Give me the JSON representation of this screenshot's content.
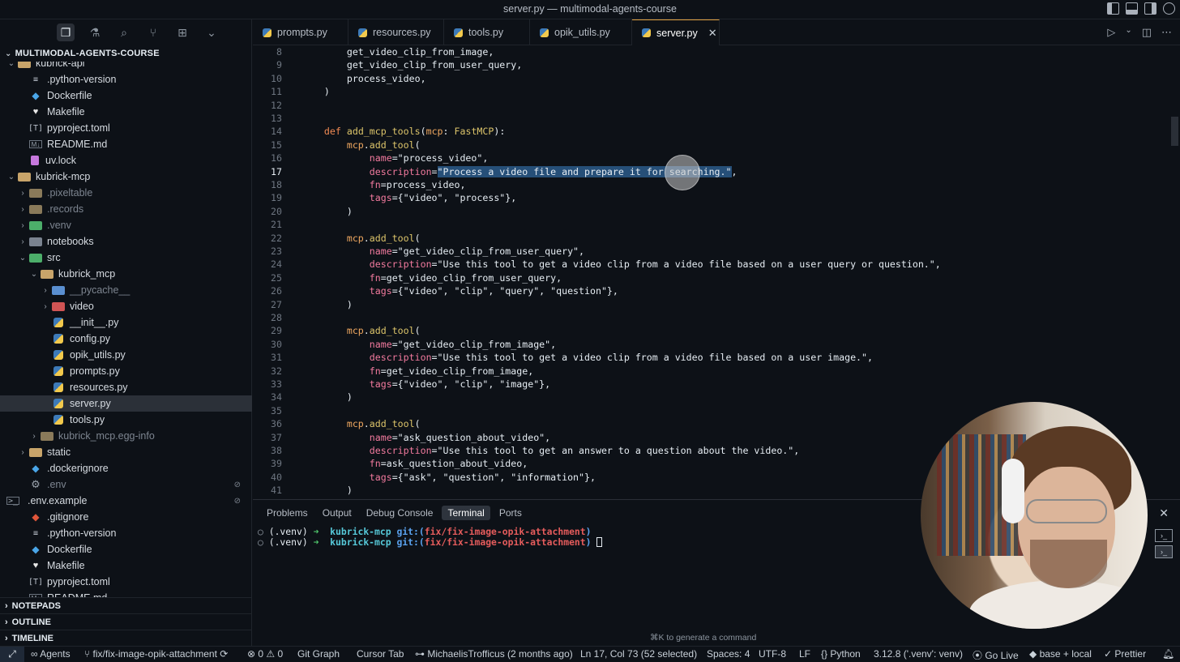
{
  "window": {
    "title": "server.py — multimodal-agents-course"
  },
  "sidebar": {
    "root": "MULTIMODAL-AGENTS-COURSE",
    "items": [
      {
        "label": "kubrick-api",
        "type": "folder",
        "depth": 1,
        "open": true
      },
      {
        "label": ".python-version",
        "type": "file",
        "depth": 2
      },
      {
        "label": "Dockerfile",
        "type": "docker",
        "depth": 2
      },
      {
        "label": "Makefile",
        "type": "make",
        "depth": 2
      },
      {
        "label": "pyproject.toml",
        "type": "toml",
        "depth": 2
      },
      {
        "label": "README.md",
        "type": "md",
        "depth": 2
      },
      {
        "label": "uv.lock",
        "type": "lock",
        "depth": 2
      },
      {
        "label": "kubrick-mcp",
        "type": "folder",
        "depth": 1,
        "open": true
      },
      {
        "label": ".pixeltable",
        "type": "folder-dim",
        "depth": 2,
        "open": false,
        "dim": true
      },
      {
        "label": ".records",
        "type": "folder-dim",
        "depth": 2,
        "open": false,
        "dim": true
      },
      {
        "label": ".venv",
        "type": "folder-green",
        "depth": 2,
        "open": false,
        "dim": true
      },
      {
        "label": "notebooks",
        "type": "folder-gray",
        "depth": 2,
        "open": false
      },
      {
        "label": "src",
        "type": "folder-green",
        "depth": 2,
        "open": true
      },
      {
        "label": "kubrick_mcp",
        "type": "folder",
        "depth": 3,
        "open": true
      },
      {
        "label": "__pycache__",
        "type": "folder-blue",
        "depth": 4,
        "open": false,
        "dim": true
      },
      {
        "label": "video",
        "type": "folder-red",
        "depth": 4,
        "open": false
      },
      {
        "label": "__init__.py",
        "type": "py",
        "depth": 4
      },
      {
        "label": "config.py",
        "type": "py",
        "depth": 4
      },
      {
        "label": "opik_utils.py",
        "type": "py",
        "depth": 4
      },
      {
        "label": "prompts.py",
        "type": "py",
        "depth": 4
      },
      {
        "label": "resources.py",
        "type": "py",
        "depth": 4
      },
      {
        "label": "server.py",
        "type": "py",
        "depth": 4,
        "selected": true
      },
      {
        "label": "tools.py",
        "type": "py",
        "depth": 4
      },
      {
        "label": "kubrick_mcp.egg-info",
        "type": "folder-dim",
        "depth": 3,
        "open": false,
        "dim": true
      },
      {
        "label": "static",
        "type": "folder",
        "depth": 2,
        "open": false
      },
      {
        "label": ".dockerignore",
        "type": "docker",
        "depth": 2
      },
      {
        "label": ".env",
        "type": "gear",
        "depth": 2,
        "dim": true,
        "badge": "⊘"
      },
      {
        "label": ".env.example",
        "type": "term",
        "depth": 2,
        "badge": "⊘"
      },
      {
        "label": ".gitignore",
        "type": "git",
        "depth": 2
      },
      {
        "label": ".python-version",
        "type": "file",
        "depth": 2
      },
      {
        "label": "Dockerfile",
        "type": "docker",
        "depth": 2
      },
      {
        "label": "Makefile",
        "type": "make",
        "depth": 2
      },
      {
        "label": "pyproject.toml",
        "type": "toml",
        "depth": 2
      },
      {
        "label": "README.md",
        "type": "md",
        "depth": 2
      }
    ],
    "sections": [
      "NOTEPADS",
      "OUTLINE",
      "TIMELINE"
    ]
  },
  "tabs": [
    {
      "label": "prompts.py"
    },
    {
      "label": "resources.py"
    },
    {
      "label": "tools.py"
    },
    {
      "label": "opik_utils.py"
    },
    {
      "label": "server.py",
      "active": true
    }
  ],
  "editor": {
    "current_line": 17,
    "lines": [
      {
        "n": "8",
        "text": "        get_video_clip_from_image,"
      },
      {
        "n": "9",
        "text": "        get_video_clip_from_user_query,"
      },
      {
        "n": "10",
        "text": "        process_video,"
      },
      {
        "n": "11",
        "text": "    )"
      },
      {
        "n": "12",
        "text": ""
      },
      {
        "n": "13",
        "text": ""
      },
      {
        "n": "14",
        "text": "    def add_mcp_tools(mcp: FastMCP):"
      },
      {
        "n": "15",
        "text": "        mcp.add_tool("
      },
      {
        "n": "16",
        "text": "            name=\"process_video\","
      },
      {
        "n": "17",
        "text": "            description=\"Process a video file and prepare it for searching.\","
      },
      {
        "n": "18",
        "text": "            fn=process_video,"
      },
      {
        "n": "19",
        "text": "            tags={\"video\", \"process\"},"
      },
      {
        "n": "20",
        "text": "        )"
      },
      {
        "n": "21",
        "text": ""
      },
      {
        "n": "22",
        "text": "        mcp.add_tool("
      },
      {
        "n": "23",
        "text": "            name=\"get_video_clip_from_user_query\","
      },
      {
        "n": "24",
        "text": "            description=\"Use this tool to get a video clip from a video file based on a user query or question.\","
      },
      {
        "n": "25",
        "text": "            fn=get_video_clip_from_user_query,"
      },
      {
        "n": "26",
        "text": "            tags={\"video\", \"clip\", \"query\", \"question\"},"
      },
      {
        "n": "27",
        "text": "        )"
      },
      {
        "n": "28",
        "text": ""
      },
      {
        "n": "29",
        "text": "        mcp.add_tool("
      },
      {
        "n": "30",
        "text": "            name=\"get_video_clip_from_image\","
      },
      {
        "n": "31",
        "text": "            description=\"Use this tool to get a video clip from a video file based on a user image.\","
      },
      {
        "n": "32",
        "text": "            fn=get_video_clip_from_image,"
      },
      {
        "n": "33",
        "text": "            tags={\"video\", \"clip\", \"image\"},"
      },
      {
        "n": "34",
        "text": "        )"
      },
      {
        "n": "35",
        "text": ""
      },
      {
        "n": "36",
        "text": "        mcp.add_tool("
      },
      {
        "n": "37",
        "text": "            name=\"ask_question_about_video\","
      },
      {
        "n": "38",
        "text": "            description=\"Use this tool to get an answer to a question about the video.\","
      },
      {
        "n": "39",
        "text": "            fn=ask_question_about_video,"
      },
      {
        "n": "40",
        "text": "            tags={\"ask\", \"question\", \"information\"},"
      },
      {
        "n": "41",
        "text": "        )"
      }
    ]
  },
  "panel": {
    "tabs": [
      "Problems",
      "Output",
      "Debug Console",
      "Terminal",
      "Ports"
    ],
    "active_tab": "Terminal",
    "terminal_lines": [
      {
        "venv": "(.venv)",
        "arrow": "➜",
        "dir": "kubrick-mcp",
        "git": "git:(",
        "branch": "fix/fix-image-opik-attachment",
        "git_end": ")"
      },
      {
        "venv": "(.venv)",
        "arrow": "➜",
        "dir": "kubrick-mcp",
        "git": "git:(",
        "branch": "fix/fix-image-opik-attachment",
        "git_end": ")"
      }
    ],
    "hint": "⌘K to generate a command"
  },
  "statusbar": {
    "remote": "⤢",
    "agents": "Agents",
    "branch": "fix/fix-image-opik-attachment",
    "errors": "0",
    "warnings": "0",
    "git_graph": "Git Graph",
    "cursor_tab": "Cursor Tab",
    "blame": "MichaelisTrofficus (2 months ago)",
    "position": "Ln 17, Col 73 (52 selected)",
    "spaces": "Spaces: 4",
    "encoding": "UTF-8",
    "eol": "LF",
    "language": "Python",
    "interpreter": "3.12.8 ('.venv': venv)",
    "go_live": "Go Live",
    "base": "base + local",
    "prettier": "Prettier"
  },
  "colors": {
    "background": "#0d1117",
    "keyword": "#f28b54",
    "function": "#dcc46a",
    "selection": "#264f78",
    "accent_tab": "#e0a040"
  }
}
